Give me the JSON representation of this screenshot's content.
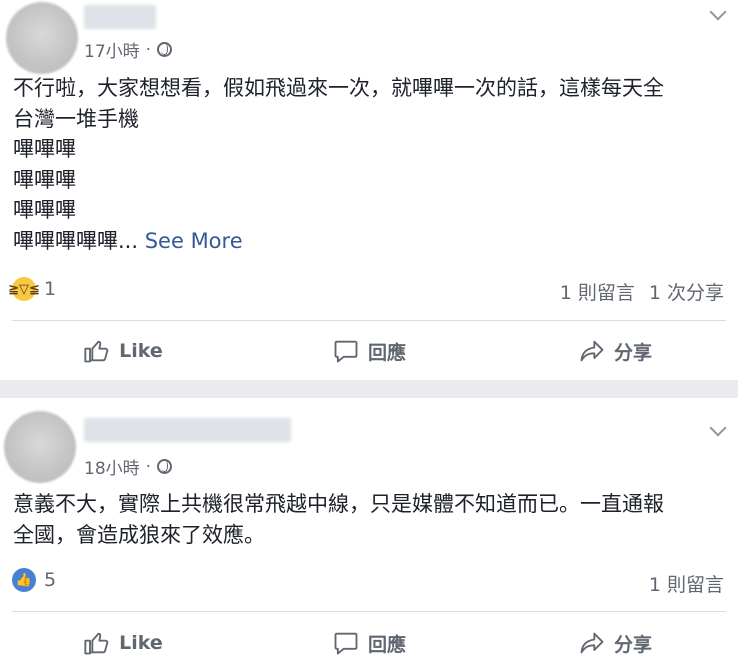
{
  "posts": [
    {
      "time": "17小時",
      "sep": "·",
      "lines": [
        "不行啦，大家想想看，假如飛過來一次，就嗶嗶一次的話，這樣每天全",
        "台灣一堆手機",
        "嗶嗶嗶",
        "嗶嗶嗶",
        "嗶嗶嗶"
      ],
      "last_line": "嗶嗶嗶嗶嗶...",
      "see_more": "See More",
      "reaction_icon": "haha-emoji-icon",
      "reaction_count": "1",
      "comments": "1 則留言",
      "shares": "1 次分享"
    },
    {
      "time": "18小時",
      "sep": "·",
      "lines": [
        "意義不大，實際上共機很常飛越中線，只是媒體不知道而已。一直通報",
        "全國，會造成狼來了效應。"
      ],
      "reaction_icon": "like-badge-icon",
      "reaction_count": "5",
      "comments": "1 則留言"
    }
  ],
  "actions": {
    "like": "Like",
    "comment": "回應",
    "share": "分享"
  }
}
